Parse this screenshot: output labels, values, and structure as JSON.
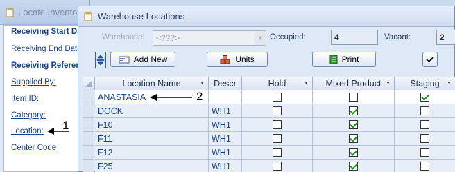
{
  "bg_window": {
    "title": "Locate Inventory",
    "items": [
      {
        "label": "Receiving Start Date",
        "style": "bold"
      },
      {
        "label": "Receiving End Date",
        "style": "plain"
      },
      {
        "label": "Receiving Reference",
        "style": "bold"
      },
      {
        "label": "Supplied By:",
        "style": "link"
      },
      {
        "label": "Item ID:",
        "style": "link"
      },
      {
        "label": "Category:",
        "style": "link"
      },
      {
        "label": "Location:",
        "style": "link"
      },
      {
        "label": "Center Code",
        "style": "link"
      }
    ]
  },
  "main_window": {
    "title": "Warehouse Locations",
    "warehouse_label": "Warehouse:",
    "warehouse_value": "<???>",
    "occupied_label": "Occupied:",
    "occupied_value": "4",
    "vacant_label": "Vacant:",
    "vacant_value": "2",
    "buttons": {
      "add_new": "Add New",
      "units": "Units",
      "print": "Print"
    }
  },
  "grid": {
    "columns": [
      "Location Name",
      "Descr",
      "Hold",
      "Mixed Product",
      "Staging"
    ],
    "rows": [
      {
        "name": "ANASTASIA",
        "descr": "",
        "hold": false,
        "mixed": false,
        "staging": true
      },
      {
        "name": "DOCK",
        "descr": "WH1",
        "hold": false,
        "mixed": true,
        "staging": false
      },
      {
        "name": "F10",
        "descr": "WH1",
        "hold": false,
        "mixed": true,
        "staging": false
      },
      {
        "name": "F11",
        "descr": "WH1",
        "hold": false,
        "mixed": true,
        "staging": false
      },
      {
        "name": "F12",
        "descr": "WH1",
        "hold": false,
        "mixed": true,
        "staging": false
      },
      {
        "name": "F25",
        "descr": "WH1",
        "hold": false,
        "mixed": true,
        "staging": false
      }
    ]
  },
  "annotations": {
    "one": "1",
    "two": "2"
  }
}
